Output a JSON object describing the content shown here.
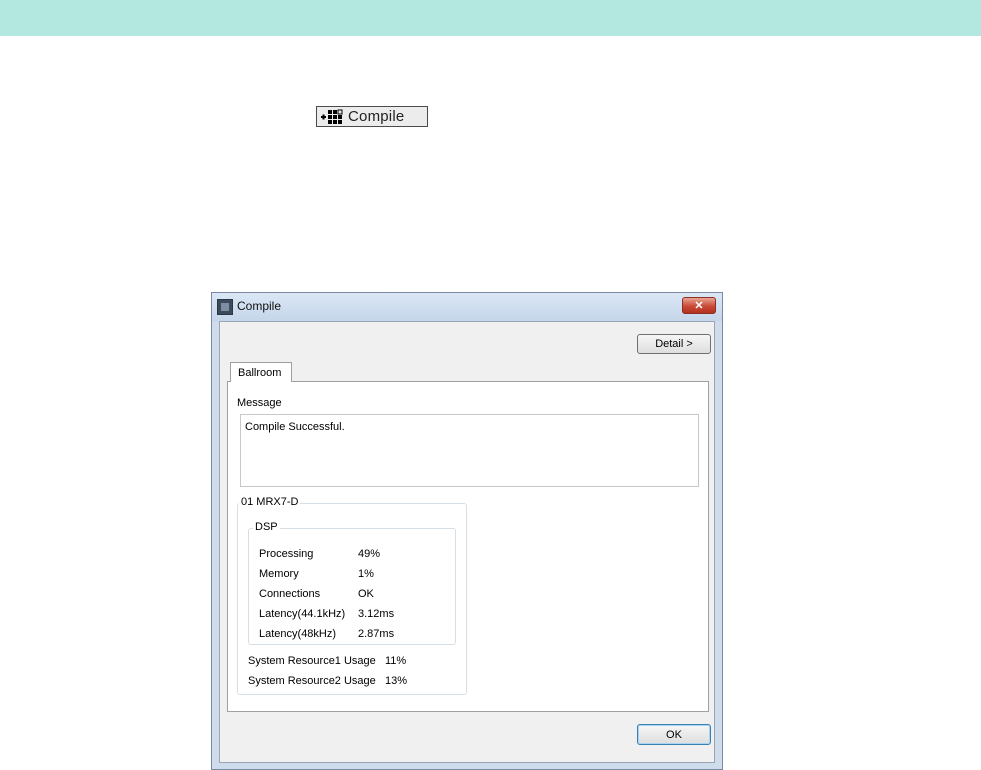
{
  "toolbar": {
    "compile_label": "Compile",
    "icon": "compile-grid-icon"
  },
  "dialog": {
    "title": "Compile",
    "close_glyph": "✕",
    "detail_label": "Detail >",
    "ok_label": "OK",
    "tab_label": "Ballroom",
    "message_label": "Message",
    "message_text": "Compile Successful.",
    "device_group": "01 MRX7-D",
    "dsp_group": "DSP",
    "dsp_rows": [
      {
        "label": "Processing",
        "value": "49%"
      },
      {
        "label": "Memory",
        "value": "1%"
      },
      {
        "label": "Connections",
        "value": "OK"
      },
      {
        "label": "Latency(44.1kHz)",
        "value": "3.12ms"
      },
      {
        "label": "Latency(48kHz)",
        "value": "2.87ms"
      }
    ],
    "resources": [
      {
        "label": "System Resource1 Usage",
        "value": "11%"
      },
      {
        "label": "System Resource2 Usage",
        "value": "13%"
      }
    ]
  },
  "colors": {
    "header_band": "#b3e8e1",
    "close_red": "#c84a37"
  }
}
